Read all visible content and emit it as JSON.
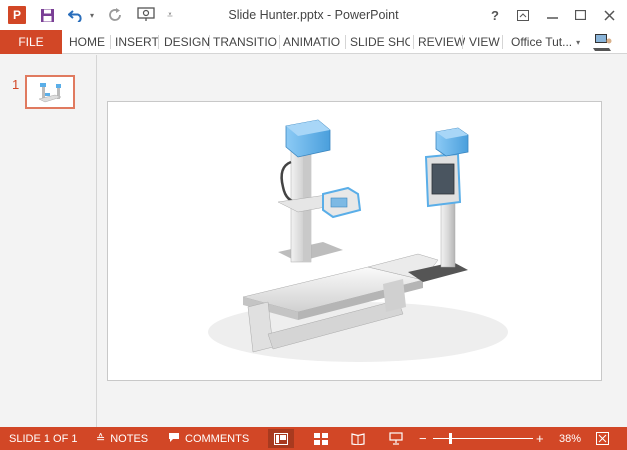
{
  "window": {
    "title": "Slide Hunter.pptx - PowerPoint",
    "help": "?",
    "app_logo": "P"
  },
  "ribbon": {
    "file": "FILE",
    "tabs": [
      "HOME",
      "INSERT",
      "DESIGN",
      "TRANSITIO",
      "ANIMATIO",
      "SLIDE SHO",
      "REVIEW",
      "VIEW"
    ],
    "account": "Office Tut..."
  },
  "thumbnails": {
    "slide_number": "1"
  },
  "status": {
    "slide_info": "SLIDE 1 OF 1",
    "notes": "NOTES",
    "comments": "COMMENTS",
    "zoom_level": "38%",
    "zoom_fraction": 0.38
  },
  "colors": {
    "accent": "#d24726",
    "device_blue": "#5aaee8"
  },
  "icons": [
    "save-icon",
    "undo-icon",
    "redo-icon",
    "present-icon",
    "customize-icon",
    "help-icon",
    "restore-ribbon-icon",
    "minimize-icon",
    "maximize-icon",
    "close-icon",
    "user-icon",
    "notes-icon",
    "comments-icon",
    "normal-view-icon",
    "slide-sorter-icon",
    "reading-view-icon",
    "slideshow-icon",
    "fit-slide-icon"
  ]
}
